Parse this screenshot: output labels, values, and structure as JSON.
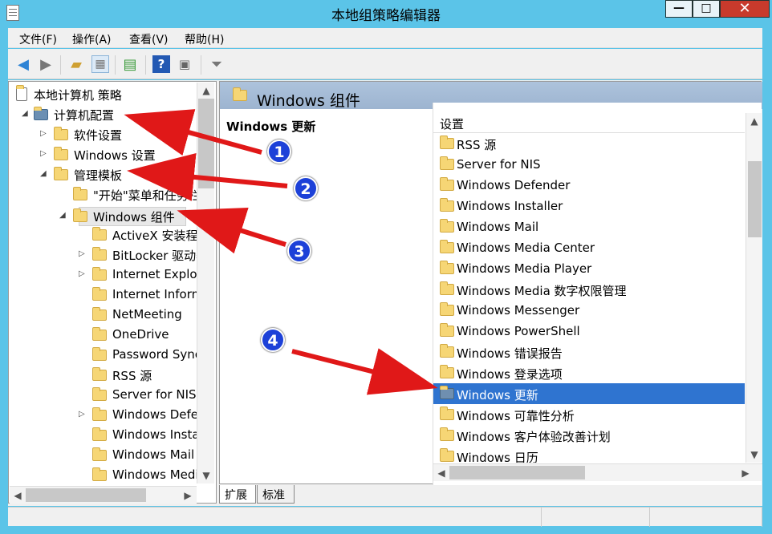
{
  "window": {
    "title": "本地组策略编辑器",
    "controls": {
      "minimize": "—",
      "maximize": "□",
      "close": "✕"
    }
  },
  "menu": [
    "文件(F)",
    "操作(A)",
    "查看(V)",
    "帮助(H)"
  ],
  "toolbar": {
    "icons": [
      "back-arrow-icon",
      "forward-arrow-icon",
      "up-folder-icon",
      "show-hide-tree-icon",
      "export-list-icon",
      "help-icon",
      "properties-icon",
      "filter-icon"
    ]
  },
  "tree": {
    "items": [
      {
        "label": "本地计算机 策略"
      },
      {
        "label": "计算机配置"
      },
      {
        "label": "软件设置"
      },
      {
        "label": "Windows 设置"
      },
      {
        "label": "管理模板"
      },
      {
        "label": "\"开始\"菜单和任务栏"
      },
      {
        "label": "Windows 组件"
      },
      {
        "label": "ActiveX 安装程序服务"
      },
      {
        "label": "BitLocker 驱动器加密"
      },
      {
        "label": "Internet Explorer"
      },
      {
        "label": "Internet Information Services"
      },
      {
        "label": "NetMeeting"
      },
      {
        "label": "OneDrive"
      },
      {
        "label": "Password Sync"
      },
      {
        "label": "RSS 源"
      },
      {
        "label": "Server for NIS"
      },
      {
        "label": "Windows Defender"
      },
      {
        "label": "Windows Installer"
      },
      {
        "label": "Windows Mail"
      },
      {
        "label": "Windows Media Center"
      }
    ]
  },
  "right_panel": {
    "title": "Windows 组件",
    "description_title": "Windows 更新",
    "column_header": "设置",
    "items": [
      "RSS 源",
      "Server for NIS",
      "Windows Defender",
      "Windows Installer",
      "Windows Mail",
      "Windows Media Center",
      "Windows Media Player",
      "Windows Media 数字权限管理",
      "Windows Messenger",
      "Windows PowerShell",
      "Windows 错误报告",
      "Windows 登录选项",
      "Windows 更新",
      "Windows 可靠性分析",
      "Windows 客户体验改善计划",
      "Windows 日历"
    ]
  },
  "tabs": [
    "扩展",
    "标准"
  ],
  "annotations": [
    "1",
    "2",
    "3",
    "4"
  ],
  "colors": {
    "window_frame": "#5bc4e8",
    "selected": "#2f74d0",
    "annotation": "#1d41d8",
    "arrow": "#e01818"
  }
}
